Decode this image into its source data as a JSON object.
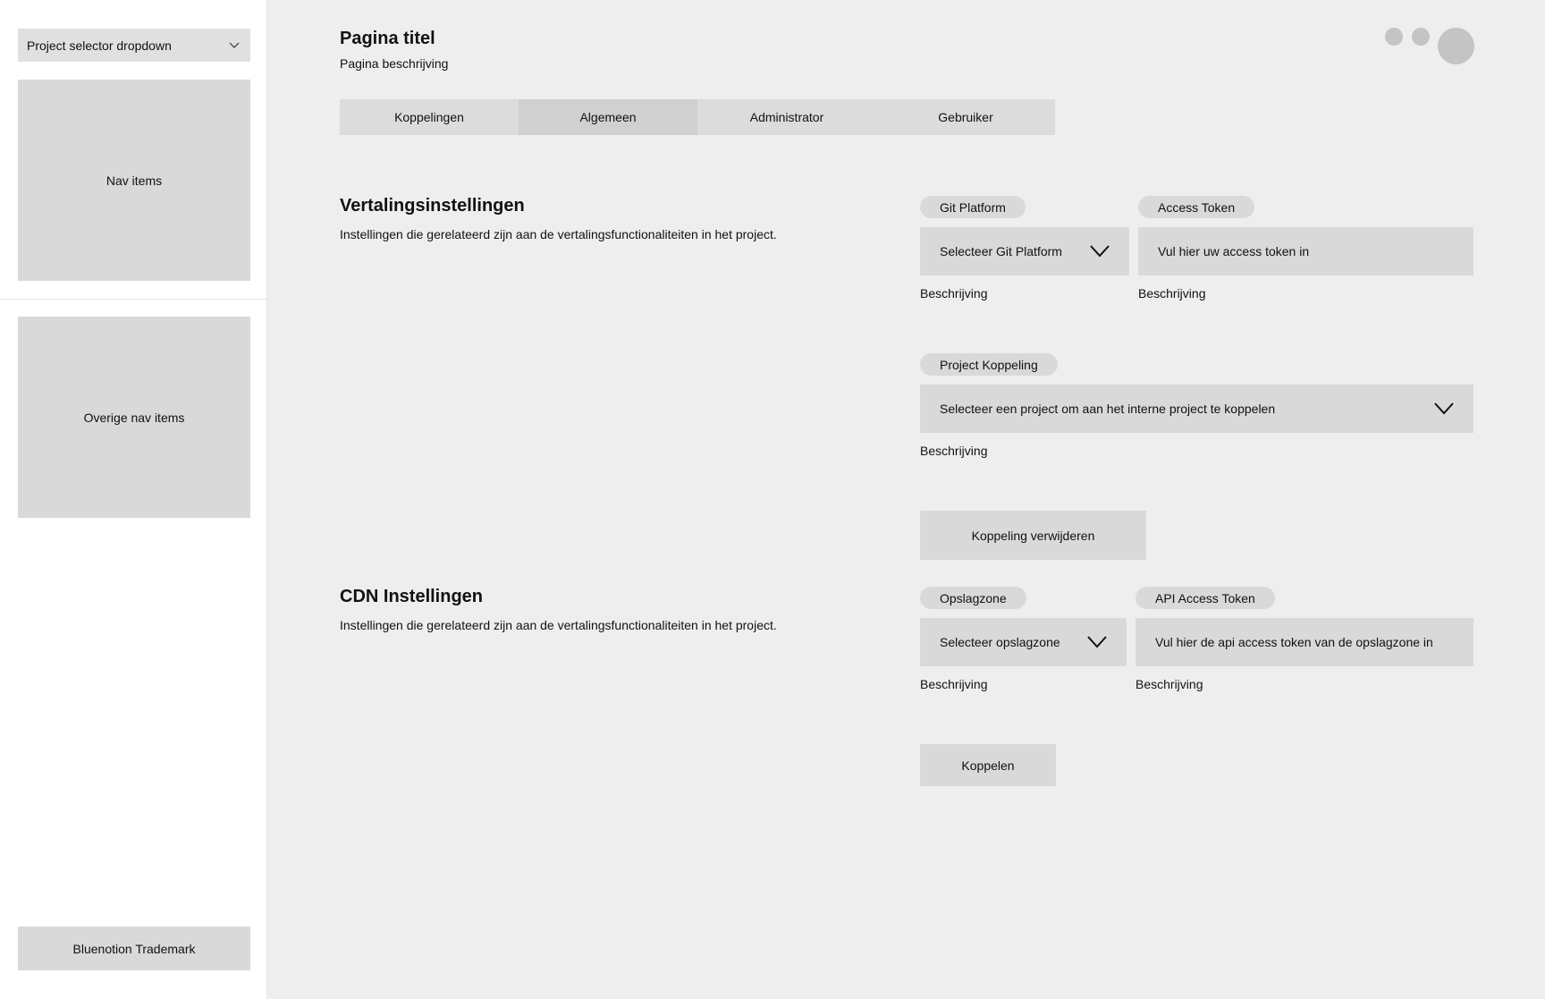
{
  "sidebar": {
    "project_selector": "Project selector dropdown",
    "nav_items": "Nav items",
    "other_nav_items": "Overige nav items",
    "trademark": "Bluenotion Trademark"
  },
  "header": {
    "title": "Pagina titel",
    "description": "Pagina beschrijving"
  },
  "tabs": [
    {
      "label": "Koppelingen",
      "active": false
    },
    {
      "label": "Algemeen",
      "active": true
    },
    {
      "label": "Administrator",
      "active": false
    },
    {
      "label": "Gebruiker",
      "active": false
    }
  ],
  "translation_settings": {
    "title": "Vertalingsinstellingen",
    "description": "Instellingen die gerelateerd zijn aan de vertalingsfunctionaliteiten in het project.",
    "git_platform": {
      "label": "Git Platform",
      "value": "Selecteer Git Platform",
      "help": "Beschrijving"
    },
    "access_token": {
      "label": "Access Token",
      "placeholder": "Vul hier uw access token in",
      "help": "Beschrijving"
    },
    "project_link": {
      "label": "Project Koppeling",
      "value": "Selecteer een project om aan het interne project te koppelen",
      "help": "Beschrijving"
    },
    "remove_button": "Koppeling verwijderen"
  },
  "cdn_settings": {
    "title": "CDN Instellingen",
    "description": "Instellingen die gerelateerd zijn aan de vertalingsfunctionaliteiten in het project.",
    "storage_zone": {
      "label": "Opslagzone",
      "value": "Selecteer opslagzone",
      "help": "Beschrijving"
    },
    "api_access_token": {
      "label": "API Access Token",
      "placeholder": "Vul hier de api access token van de opslagzone in",
      "help": "Beschrijving"
    },
    "link_button": "Koppelen"
  },
  "colors": {
    "sidebar_bg": "#ffffff",
    "main_bg": "#eeeeee",
    "placeholder_gray": "#d9d9d9",
    "icon_gray": "#c4c4c4"
  }
}
